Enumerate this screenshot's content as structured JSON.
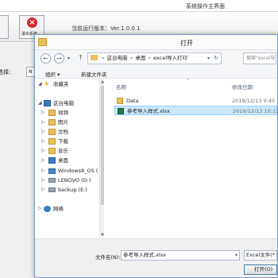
{
  "main_window": {
    "title": "系统操作主界面",
    "exit_button_label": "退出系统",
    "version_text": "当前运行版本：Ver.1.0.0.1",
    "machine_select_label": "机选择：",
    "machine_select_value": "N"
  },
  "dialog": {
    "title": "打开",
    "nav": {
      "back_glyph": "←",
      "forward_glyph": "→",
      "dropdown_glyph": "▾",
      "up_glyph": "↑"
    },
    "address": {
      "sep": "»",
      "crumbs": [
        "这台电脑",
        "桌面",
        "excel导入打印"
      ],
      "dropdown_glyph": "▾",
      "refresh_glyph": "↻"
    },
    "search_placeholder": "搜索\"excel导入...",
    "commands": {
      "organize": "组织 ▾",
      "new_folder": "新建文件夹"
    },
    "navpane": {
      "favorites": "收藏夹",
      "this_pc": "这台电脑",
      "items": [
        "视频",
        "图片",
        "文档",
        "下载",
        "音乐",
        "桌面"
      ],
      "drives": [
        "Windows8_OS (",
        "LENOVO (D:)",
        "backup (E:)"
      ],
      "network": "网络",
      "expander_collapsed": "▷",
      "expander_expanded": "◢",
      "scroll_up": "▲",
      "scroll_down": "▼"
    },
    "files": {
      "col_name": "名称",
      "col_date": "修改日期",
      "sort_glyph": "^",
      "rows": [
        {
          "name": "Data",
          "date": "2019/12/13 9:45",
          "type": "folder",
          "selected": false
        },
        {
          "name": "参考导入样式.xlsx",
          "date": "2019/12/13 10:11",
          "type": "xlsx",
          "selected": true
        }
      ]
    },
    "bottom": {
      "filename_label": "文件名(N):",
      "filename_value": "参考导入样式.xlsx",
      "filetype_value": "Excel文件(*",
      "dropdown_glyph": "▾",
      "open_button": "打开(O)"
    }
  },
  "colors": {
    "accent_blue": "#3c7fb1",
    "selection": "#cce8ff",
    "folder": "#e8c15a",
    "exit_red": "#d6262d"
  }
}
